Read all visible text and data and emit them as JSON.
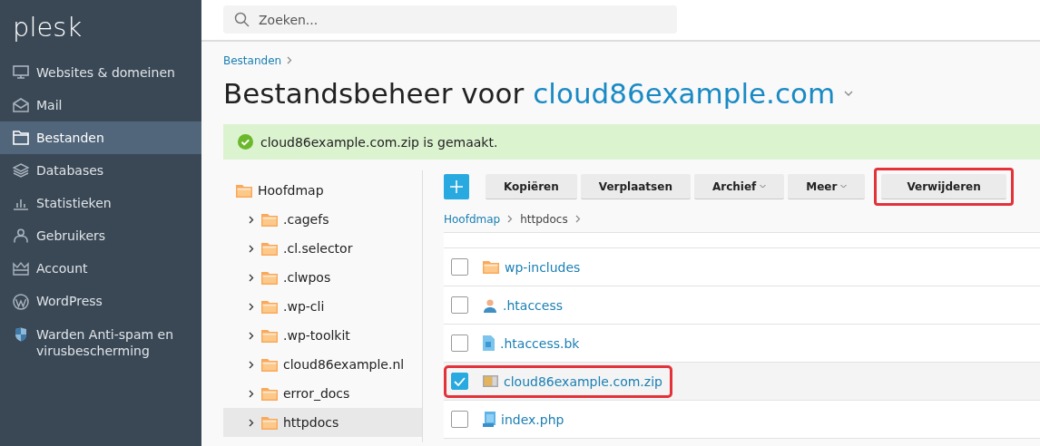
{
  "sidebar": {
    "logo": "plesk",
    "items": [
      {
        "label": "Websites & domeinen",
        "selected": false
      },
      {
        "label": "Mail",
        "selected": false
      },
      {
        "label": "Bestanden",
        "selected": true
      },
      {
        "label": "Databases",
        "selected": false
      },
      {
        "label": "Statistieken",
        "selected": false
      },
      {
        "label": "Gebruikers",
        "selected": false
      },
      {
        "label": "Account",
        "selected": false
      },
      {
        "label": "WordPress",
        "selected": false
      },
      {
        "label": "Warden Anti-spam en virusbescherming",
        "selected": false
      }
    ]
  },
  "search": {
    "placeholder": "Zoeken..."
  },
  "breadcrumb": [
    "Bestanden"
  ],
  "title": {
    "text": "Bestandsbeheer voor",
    "domain": "cloud86example.com"
  },
  "message": {
    "text": "cloud86example.com.zip is gemaakt."
  },
  "tree": {
    "root": "Hoofdmap",
    "children": [
      {
        "label": ".cagefs",
        "expanded": false,
        "selected": false
      },
      {
        "label": ".cl.selector",
        "expanded": false,
        "selected": false
      },
      {
        "label": ".clwpos",
        "expanded": false,
        "selected": false
      },
      {
        "label": ".wp-cli",
        "expanded": false,
        "selected": false
      },
      {
        "label": ".wp-toolkit",
        "expanded": false,
        "selected": false
      },
      {
        "label": "cloud86example.nl",
        "expanded": false,
        "selected": false
      },
      {
        "label": "error_docs",
        "expanded": false,
        "selected": false
      },
      {
        "label": "httpdocs",
        "expanded": false,
        "selected": true
      }
    ]
  },
  "toolbar": [
    {
      "kind": "add"
    },
    {
      "kind": "plain",
      "label": "Kopiëren",
      "highlighted": false
    },
    {
      "kind": "plain",
      "label": "Verplaatsen",
      "highlighted": false
    },
    {
      "kind": "menu",
      "label": "Archief",
      "highlighted": false
    },
    {
      "kind": "menu",
      "label": "Meer",
      "highlighted": false
    },
    {
      "kind": "plain",
      "label": "Verwijderen",
      "highlighted": true
    }
  ],
  "path": [
    "Hoofdmap",
    "httpdocs"
  ],
  "files": [
    {
      "name": "wp-includes",
      "kind": "folder",
      "checked": false,
      "highlighted": false
    },
    {
      "name": ".htaccess",
      "kind": "user",
      "checked": false,
      "highlighted": false
    },
    {
      "name": ".htaccess.bk",
      "kind": "file",
      "checked": false,
      "highlighted": false
    },
    {
      "name": "cloud86example.com.zip",
      "kind": "archive",
      "checked": true,
      "highlighted": true
    },
    {
      "name": "index.php",
      "kind": "script",
      "checked": false,
      "highlighted": false
    }
  ]
}
